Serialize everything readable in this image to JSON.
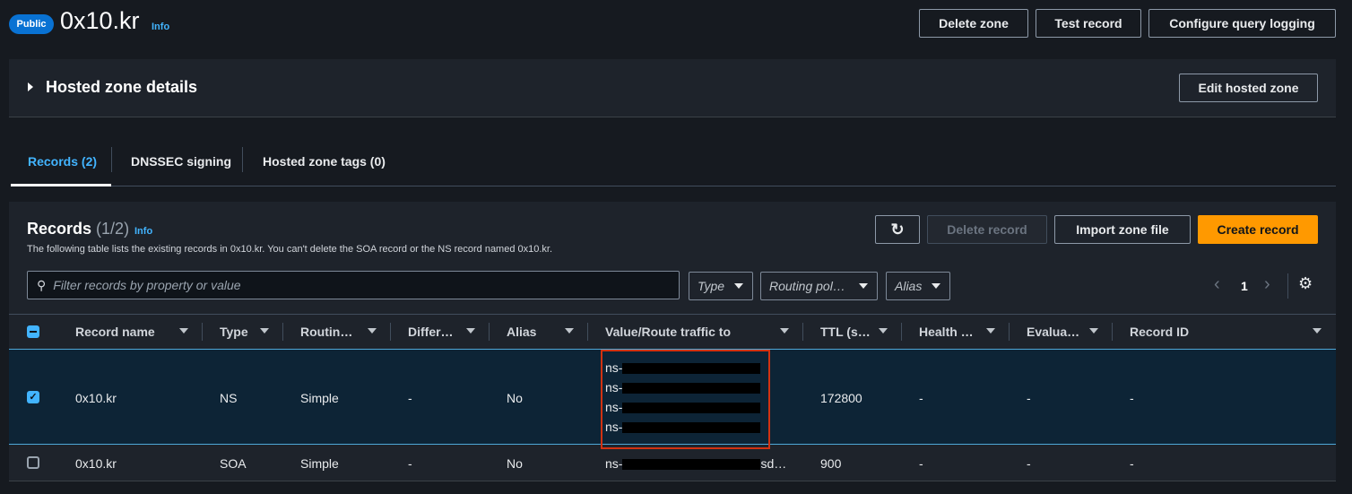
{
  "header": {
    "badge": "Public",
    "title": "0x10.kr",
    "info": "Info",
    "buttons": {
      "delete_zone": "Delete zone",
      "test_record": "Test record",
      "configure_logging": "Configure query logging"
    }
  },
  "details": {
    "title": "Hosted zone details",
    "edit": "Edit hosted zone"
  },
  "tabs": [
    {
      "label": "Records (2)",
      "active": true
    },
    {
      "label": "DNSSEC signing"
    },
    {
      "label": "Hosted zone tags (0)"
    }
  ],
  "records": {
    "title": "Records",
    "count": "(1/2)",
    "info": "Info",
    "description": "The following table lists the existing records in 0x10.kr. You can't delete the SOA record or the NS record named 0x10.kr.",
    "buttons": {
      "delete": "Delete record",
      "import": "Import zone file",
      "create": "Create record"
    },
    "filter_placeholder": "Filter records by property or value",
    "filters": {
      "type": "Type",
      "routing": "Routing pol…",
      "alias": "Alias"
    },
    "page": "1",
    "columns": [
      "Record name",
      "Type",
      "Routin…",
      "Differ…",
      "Alias",
      "Value/Route traffic to",
      "TTL (s…",
      "Health …",
      "Evalua…",
      "Record ID"
    ],
    "rows": [
      {
        "selected": true,
        "name": "0x10.kr",
        "type": "NS",
        "routing": "Simple",
        "differ": "-",
        "alias": "No",
        "values": [
          "ns-",
          "ns-",
          "ns-",
          "ns-"
        ],
        "ttl": "172800",
        "health": "-",
        "evaluate": "-",
        "record_id": "-"
      },
      {
        "selected": false,
        "name": "0x10.kr",
        "type": "SOA",
        "routing": "Simple",
        "differ": "-",
        "alias": "No",
        "values": [
          "ns-",
          "sd…"
        ],
        "ttl": "900",
        "health": "-",
        "evaluate": "-",
        "record_id": "-"
      }
    ]
  },
  "colors": {
    "accent": "#ec7211",
    "link": "#42b4ff",
    "highlight": "#d13212"
  }
}
